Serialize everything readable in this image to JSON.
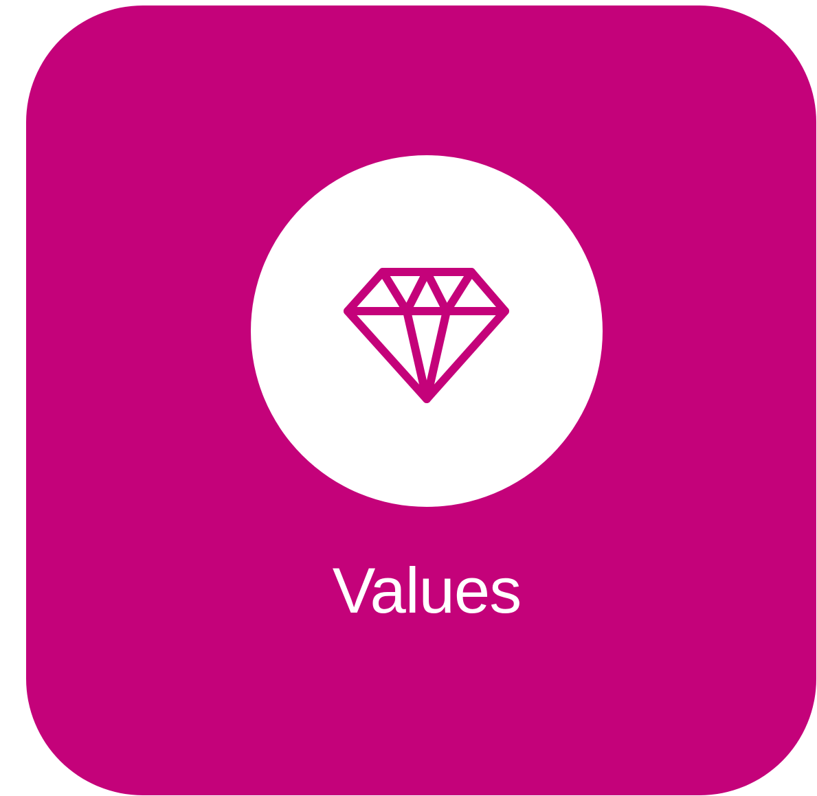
{
  "tile": {
    "label": "Values",
    "background_color": "#c4027a",
    "icon": "diamond-icon"
  }
}
